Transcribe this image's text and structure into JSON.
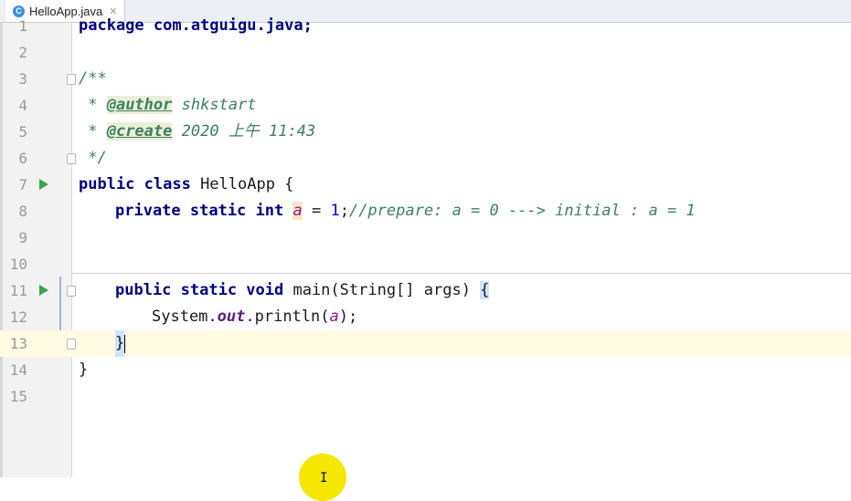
{
  "tab": {
    "filename": "HelloApp.java",
    "icon_letter": "C"
  },
  "lines": [
    {
      "num": "1",
      "code": "package com.atguigu.java;"
    },
    {
      "num": "2",
      "code": ""
    },
    {
      "num": "3",
      "code": "/**"
    },
    {
      "num": "4",
      "prefix": " * ",
      "tag": "@author",
      "rest": " shkstart"
    },
    {
      "num": "5",
      "prefix": " * ",
      "tag": "@create",
      "rest": " 2020 上午 11:43"
    },
    {
      "num": "6",
      "code": " */"
    },
    {
      "num": "7",
      "kw": "public class",
      "rest": " HelloApp {"
    },
    {
      "num": "8",
      "kw": "private static int",
      "field": "a",
      "eq": " = ",
      "value": "1",
      "semi": ";",
      "comment": "//prepare: a = 0 ---> initial : a = 1"
    },
    {
      "num": "9",
      "code": ""
    },
    {
      "num": "10",
      "code": ""
    },
    {
      "num": "11",
      "kw": "public static void",
      "rest": " main(String[] args) ",
      "brace": "{"
    },
    {
      "num": "12",
      "pre": "System.",
      "out": "out",
      "mid": ".println(",
      "arg": "a",
      "end": ");"
    },
    {
      "num": "13",
      "code": "}"
    },
    {
      "num": "14",
      "code": "}"
    },
    {
      "num": "15",
      "code": ""
    }
  ]
}
